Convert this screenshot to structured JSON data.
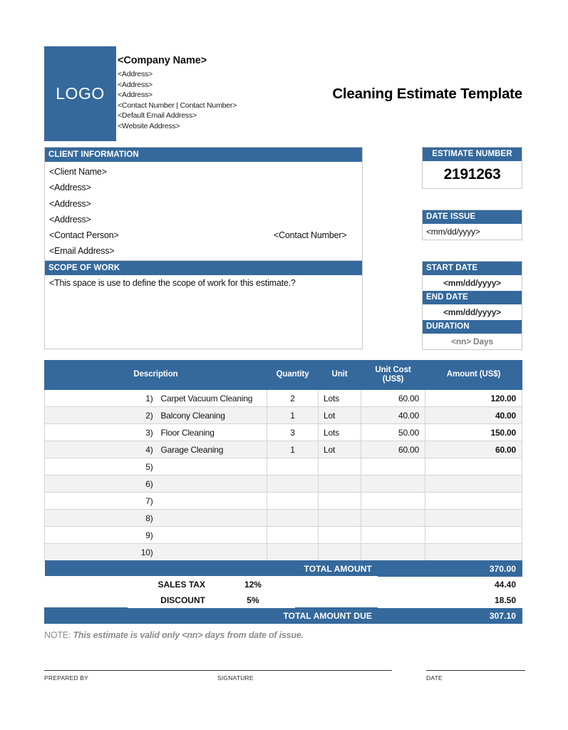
{
  "brand": {
    "accent": "#35699c",
    "logo_text": "LOGO"
  },
  "header": {
    "company_name": "<Company Name>",
    "company_lines": [
      "<Address>",
      "<Address>",
      "<Address>",
      "<Contact Number | Contact Number>",
      "<Default Email Address>",
      "<Website Address>"
    ],
    "document_title": "Cleaning Estimate Template"
  },
  "client": {
    "section_title": "CLIENT INFORMATION",
    "name": "<Client Name>",
    "address_1": "<Address>",
    "address_2": "<Address>",
    "address_3": "<Address>",
    "contact_person": "<Contact Person>",
    "contact_number": "<Contact Number>",
    "email": "<Email Address>"
  },
  "scope": {
    "section_title": "SCOPE OF WORK",
    "text": "<This space is use to define the scope of work for this estimate.?"
  },
  "estimate": {
    "label": "ESTIMATE NUMBER",
    "number": "2191263"
  },
  "date_issue": {
    "label": "DATE ISSUE",
    "value": "<mm/dd/yyyy>"
  },
  "schedule": {
    "start_label": "START DATE",
    "start_value": "<mm/dd/yyyy>",
    "end_label": "END DATE",
    "end_value": "<mm/dd/yyyy>",
    "duration_label": "DURATION",
    "duration_value": "<nn> Days"
  },
  "items_table": {
    "columns": {
      "description": "Description",
      "quantity": "Quantity",
      "unit": "Unit",
      "unit_cost": "Unit Cost (US$)",
      "unit_cost_line1": "Unit Cost",
      "unit_cost_line2": "(US$)",
      "amount": "Amount (US$)"
    },
    "rows": [
      {
        "num": "1)",
        "description": "Carpet Vacuum Cleaning",
        "quantity": "2",
        "unit": "Lots",
        "unit_cost": "60.00",
        "amount": "120.00"
      },
      {
        "num": "2)",
        "description": "Balcony Cleaning",
        "quantity": "1",
        "unit": "Lot",
        "unit_cost": "40.00",
        "amount": "40.00"
      },
      {
        "num": "3)",
        "description": "Floor Cleaning",
        "quantity": "3",
        "unit": "Lots",
        "unit_cost": "50.00",
        "amount": "150.00"
      },
      {
        "num": "4)",
        "description": "Garage Cleaning",
        "quantity": "1",
        "unit": "Lot",
        "unit_cost": "60.00",
        "amount": "60.00"
      },
      {
        "num": "5)",
        "description": "",
        "quantity": "",
        "unit": "",
        "unit_cost": "",
        "amount": ""
      },
      {
        "num": "6)",
        "description": "",
        "quantity": "",
        "unit": "",
        "unit_cost": "",
        "amount": ""
      },
      {
        "num": "7)",
        "description": "",
        "quantity": "",
        "unit": "",
        "unit_cost": "",
        "amount": ""
      },
      {
        "num": "8)",
        "description": "",
        "quantity": "",
        "unit": "",
        "unit_cost": "",
        "amount": ""
      },
      {
        "num": "9)",
        "description": "",
        "quantity": "",
        "unit": "",
        "unit_cost": "",
        "amount": ""
      },
      {
        "num": "10)",
        "description": "",
        "quantity": "",
        "unit": "",
        "unit_cost": "",
        "amount": ""
      }
    ]
  },
  "totals": {
    "total_amount_label": "TOTAL AMOUNT",
    "total_amount_value": "370.00",
    "sales_tax_label": "SALES TAX",
    "sales_tax_rate": "12%",
    "sales_tax_value": "44.40",
    "discount_label": "DISCOUNT",
    "discount_rate": "5%",
    "discount_value": "18.50",
    "total_due_label": "TOTAL AMOUNT DUE",
    "total_due_value": "307.10"
  },
  "footer": {
    "note_label": "NOTE: ",
    "note_text": "This estimate is valid only <nn> days from date of issue.",
    "prepared_by": "PREPARED BY",
    "signature": "SIGNATURE",
    "date": "DATE"
  }
}
